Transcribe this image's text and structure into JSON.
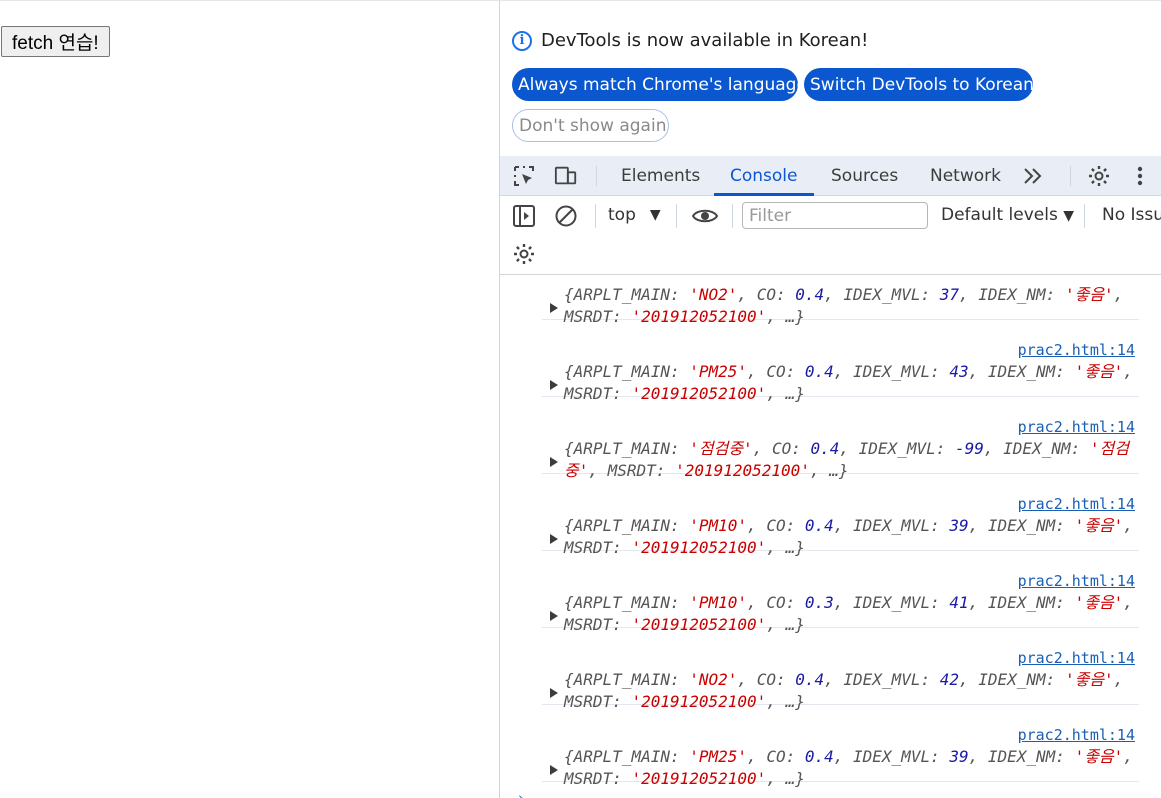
{
  "page": {
    "fetch_button": "fetch 연습!"
  },
  "infobar": {
    "message": "DevTools is now available in Korean!",
    "btn_match": "Always match Chrome's language",
    "btn_switch": "Switch DevTools to Korean",
    "btn_dismiss": "Don't show again"
  },
  "tabs": [
    "Elements",
    "Console",
    "Sources",
    "Network"
  ],
  "toolbar": {
    "context": "top",
    "filter_placeholder": "Filter",
    "levels": "Default levels",
    "issues": "No Issu"
  },
  "console": {
    "entries": [
      {
        "source": "",
        "main": "NO2",
        "co": "0.4",
        "mvl": "37",
        "nm": "좋음",
        "dt": "201912052100"
      },
      {
        "source": "prac2.html:14",
        "main": "PM25",
        "co": "0.4",
        "mvl": "43",
        "nm": "좋음",
        "dt": "201912052100"
      },
      {
        "source": "prac2.html:14",
        "main": "점검중",
        "co": "0.4",
        "mvl": "-99",
        "nm": "점검중",
        "dt": "201912052100"
      },
      {
        "source": "prac2.html:14",
        "main": "PM10",
        "co": "0.4",
        "mvl": "39",
        "nm": "좋음",
        "dt": "201912052100"
      },
      {
        "source": "prac2.html:14",
        "main": "PM10",
        "co": "0.3",
        "mvl": "41",
        "nm": "좋음",
        "dt": "201912052100"
      },
      {
        "source": "prac2.html:14",
        "main": "NO2",
        "co": "0.4",
        "mvl": "42",
        "nm": "좋음",
        "dt": "201912052100"
      },
      {
        "source": "prac2.html:14",
        "main": "PM25",
        "co": "0.4",
        "mvl": "39",
        "nm": "좋음",
        "dt": "201912052100"
      }
    ]
  },
  "colors": {
    "accent": "#0b57d0",
    "string": "#c80000",
    "number": "#1a1aa6"
  }
}
